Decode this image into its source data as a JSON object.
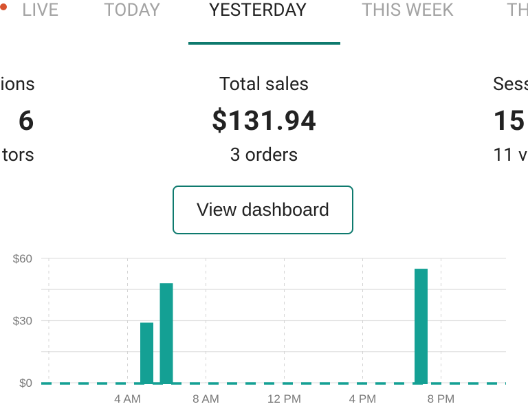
{
  "tabs": [
    {
      "label": "LIVE",
      "active": false,
      "indicator_color": "#d8522e"
    },
    {
      "label": "TODAY",
      "active": false
    },
    {
      "label": "YESTERDAY",
      "active": true
    },
    {
      "label": "THIS WEEK",
      "active": false
    },
    {
      "label": "TH",
      "active": false
    }
  ],
  "stats": {
    "left": {
      "label": "ions",
      "value": "6",
      "sub": "tors"
    },
    "center": {
      "label": "Total sales",
      "value": "$131.94",
      "sub": "3 orders"
    },
    "right": {
      "label": "Sess",
      "value": "15",
      "sub": "11 v"
    }
  },
  "button": {
    "label": "View dashboard"
  },
  "colors": {
    "accent": "#0e7a6e",
    "bar": "#14a094",
    "live_dot": "#d8522e"
  },
  "chart_data": {
    "type": "bar",
    "x_unit": "hour",
    "x": [
      5,
      6,
      19
    ],
    "values": [
      29,
      48,
      55
    ],
    "baseline_style": "dashed line at $0 for hours with no sales",
    "xlim": [
      0,
      23.5
    ],
    "x_ticks": [
      {
        "hour": 4,
        "label": "4 AM"
      },
      {
        "hour": 8,
        "label": "8 AM"
      },
      {
        "hour": 12,
        "label": "12 PM"
      },
      {
        "hour": 16,
        "label": "4 PM"
      },
      {
        "hour": 20,
        "label": "8 PM"
      }
    ],
    "y_ticks": [
      {
        "value": 0,
        "label": "$0"
      },
      {
        "value": 30,
        "label": "$30"
      },
      {
        "value": 60,
        "label": "$60"
      }
    ],
    "ylim": [
      0,
      60
    ],
    "grid": true
  }
}
